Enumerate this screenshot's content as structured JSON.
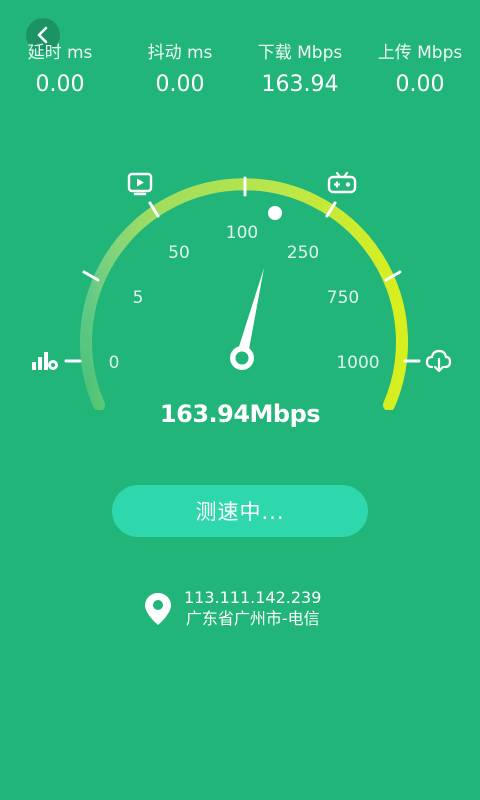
{
  "stats": [
    {
      "label": "延时 ms",
      "value": "0.00"
    },
    {
      "label": "抖动 ms",
      "value": "0.00"
    },
    {
      "label": "下载 Mbps",
      "value": "163.94"
    },
    {
      "label": "上传 Mbps",
      "value": "0.00"
    }
  ],
  "gauge": {
    "scale_labels": [
      "0",
      "5",
      "50",
      "100",
      "250",
      "750",
      "1000"
    ],
    "current_speed_mbps": 163.94
  },
  "speed_display": "163.94Mbps",
  "status_button_label": "测速中...",
  "location": {
    "ip": "113.111.142.239",
    "region": "广东省广州市-电信"
  },
  "colors": {
    "background": "#22b57a",
    "button": "#2fd7ac",
    "arc_start": "#9fdc5f",
    "arc_end": "#d7ef1e"
  },
  "icons": [
    "back-arrow-icon",
    "video-icon",
    "game-icon",
    "signal-bars-icon",
    "cloud-download-icon",
    "location-pin-icon"
  ]
}
